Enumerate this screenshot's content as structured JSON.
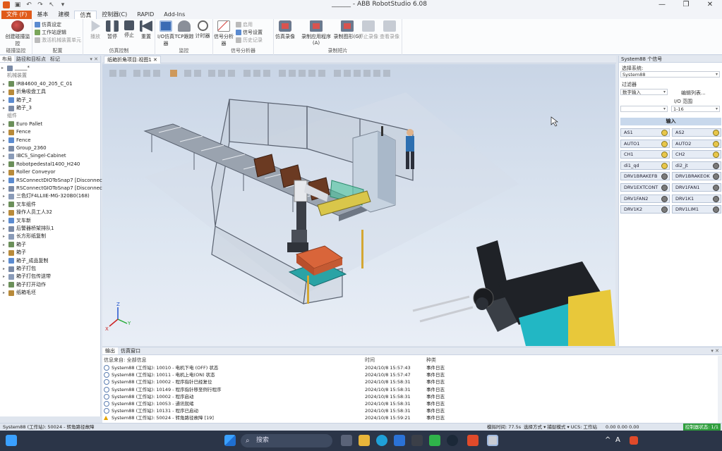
{
  "titlebar": {
    "title": "______ - ABB RobotStudio 6.08",
    "minimize": "—",
    "restore": "❐",
    "close": "✕"
  },
  "tabs": [
    "文件 (F)",
    "基本",
    "建模",
    "仿真",
    "控制器(C)",
    "RAPID",
    "Add-Ins"
  ],
  "ribbon": {
    "groups": [
      {
        "label": "碰撞监控",
        "buttons": [
          {
            "label": "创建碰撞监控"
          }
        ]
      },
      {
        "label": "配置",
        "small": [
          {
            "label": "仿真设定"
          },
          {
            "label": "工作站逻辑"
          },
          {
            "label": "激活机械装置单元"
          }
        ]
      },
      {
        "label": "仿真控制",
        "buttons": [
          {
            "label": "播放"
          },
          {
            "label": "暂停"
          },
          {
            "label": "停止"
          },
          {
            "label": "重置"
          }
        ]
      },
      {
        "label": "监控",
        "buttons": [
          {
            "label": "I/O仿真器"
          },
          {
            "label": "TCP跟踪"
          },
          {
            "label": "计时器"
          }
        ]
      },
      {
        "label": "信号分析器",
        "buttons": [
          {
            "label": "信号分析器"
          }
        ],
        "small": [
          {
            "label": "启用"
          },
          {
            "label": "信号设置"
          },
          {
            "label": "历史记录"
          }
        ]
      },
      {
        "label": "录制短片",
        "buttons": [
          {
            "label": "仿真录像"
          },
          {
            "label": "录制应用程序(A)"
          },
          {
            "label": "录制图形(G)"
          },
          {
            "label": "停止录像"
          },
          {
            "label": "查看录像"
          }
        ]
      }
    ]
  },
  "left_panel": {
    "tabs": [
      "布局",
      "路径和目标点",
      "标记"
    ],
    "pin": "▾ ✕",
    "tree": [
      {
        "label": "_____*",
        "kind": "root"
      },
      {
        "label": "机械装置",
        "kind": "header"
      },
      {
        "label": "IRB4600_40_205_C_01"
      },
      {
        "label": "折角吸盘工具"
      },
      {
        "label": "箱子_2"
      },
      {
        "label": "箱子_3"
      },
      {
        "label": "组件",
        "kind": "header"
      },
      {
        "label": "Euro Pallet"
      },
      {
        "label": "Fence"
      },
      {
        "label": "Fence"
      },
      {
        "label": "Group_2360"
      },
      {
        "label": "IBCS_Singel-Cabinet"
      },
      {
        "label": "Robotpedestal1400_H240"
      },
      {
        "label": "Roller Conveyor"
      },
      {
        "label": "RSConnectDIOToSnap7 [Disconnected]"
      },
      {
        "label": "RSConnectGIOToSnap7 [Disconnected]"
      },
      {
        "label": "三色灯F4LLIIE-MG-320B0(168)"
      },
      {
        "label": "叉车组件"
      },
      {
        "label": "操作人员工人32"
      },
      {
        "label": "叉车新"
      },
      {
        "label": "后警器桥架排队1"
      },
      {
        "label": "长方形纸复制"
      },
      {
        "label": "箱子"
      },
      {
        "label": "箱子"
      },
      {
        "label": "箱子_成品复制"
      },
      {
        "label": "箱子打包"
      },
      {
        "label": "箱子打包传送带"
      },
      {
        "label": "箱子打开动作"
      },
      {
        "label": "纸箱毛坯"
      }
    ]
  },
  "document_tab": "纸箱折角项目:视图1 ✕",
  "right_panel": {
    "title": "System88 个信号",
    "select_system_label": "选择系统:",
    "system_value": "System88",
    "filter_label": "过滤器",
    "filter_value": "数字输入",
    "edit_list": "编辑列表...",
    "io_range_label": "I/O 范围",
    "io_range_value": "1-16",
    "section": "输入",
    "signals": [
      {
        "name": "AS1",
        "led": "yellow"
      },
      {
        "name": "AS2",
        "led": "yellow"
      },
      {
        "name": "AUTO1",
        "led": "yellow"
      },
      {
        "name": "AUTO2",
        "led": "yellow"
      },
      {
        "name": "CH1",
        "led": "yellow"
      },
      {
        "name": "CH2",
        "led": "yellow"
      },
      {
        "name": "di1_qd",
        "led": "yellow"
      },
      {
        "name": "di2_jt",
        "led": "grey"
      },
      {
        "name": "DRV1BRAKEFB",
        "led": "grey"
      },
      {
        "name": "DRV1BRAKEOK",
        "led": "grey"
      },
      {
        "name": "DRV1EXTCONT",
        "led": "grey"
      },
      {
        "name": "DRV1FAN1",
        "led": "grey"
      },
      {
        "name": "DRV1FAN2",
        "led": "grey"
      },
      {
        "name": "DRV1K1",
        "led": "grey"
      },
      {
        "name": "DRV1K2",
        "led": "grey"
      },
      {
        "name": "DRV1LIM1",
        "led": "grey"
      }
    ]
  },
  "output": {
    "tabs": [
      "输出",
      "仿真窗口"
    ],
    "pin": "▾ ✕",
    "filter_label": "信息来自: 全部信息",
    "col_time": "时间",
    "col_category": "种类",
    "rows": [
      {
        "icon": "info",
        "message": "System88 (工作站): 10010 - 电机下电 (OFF) 状态",
        "time": "2024/10/8 15:57:43",
        "category": "事件日志"
      },
      {
        "icon": "info",
        "message": "System88 (工作站): 10011 - 电机上电(ON) 状态",
        "time": "2024/10/8 15:57:47",
        "category": "事件日志"
      },
      {
        "icon": "info",
        "message": "System88 (工作站): 10002 - 程序指针已经复位",
        "time": "2024/10/8 15:58:31",
        "category": "事件日志"
      },
      {
        "icon": "info",
        "message": "System88 (工作站): 10149 - 程序指针移至例行程序",
        "time": "2024/10/8 15:58:31",
        "category": "事件日志"
      },
      {
        "icon": "info",
        "message": "System88 (工作站): 10002 - 程序启动",
        "time": "2024/10/8 15:58:31",
        "category": "事件日志"
      },
      {
        "icon": "info",
        "message": "System88 (工作站): 10053 - 通讯就绪",
        "time": "2024/10/8 15:58:31",
        "category": "事件日志"
      },
      {
        "icon": "info",
        "message": "System88 (工作站): 10131 - 程序已启动",
        "time": "2024/10/8 15:58:31",
        "category": "事件日志"
      },
      {
        "icon": "warn",
        "message": "System88 (工作站): 50024 - 转角路径故障 [19]",
        "time": "2024/10/8 15:59:21",
        "category": "事件日志"
      }
    ]
  },
  "statusbar": {
    "left": "System88 (工作站): 50024 - 转角路径故障",
    "sim_time": "模拟时间: 77.5s",
    "selection": "选择方式 ▾ 捕捉模式 ▾ UCS: 工作站",
    "coords": "0.00 0.00 0.00",
    "controller": "控制器状态: 1/1"
  },
  "taskbar": {
    "search": "搜索",
    "search_icon": "search-icon",
    "tray_a": "A",
    "tray_up": "^"
  },
  "colors": {
    "file_tab": "#e05a1a",
    "accent": "#3b6cb4",
    "led_on": "#e8c64a",
    "controller_ok": "#2e9e3c"
  }
}
